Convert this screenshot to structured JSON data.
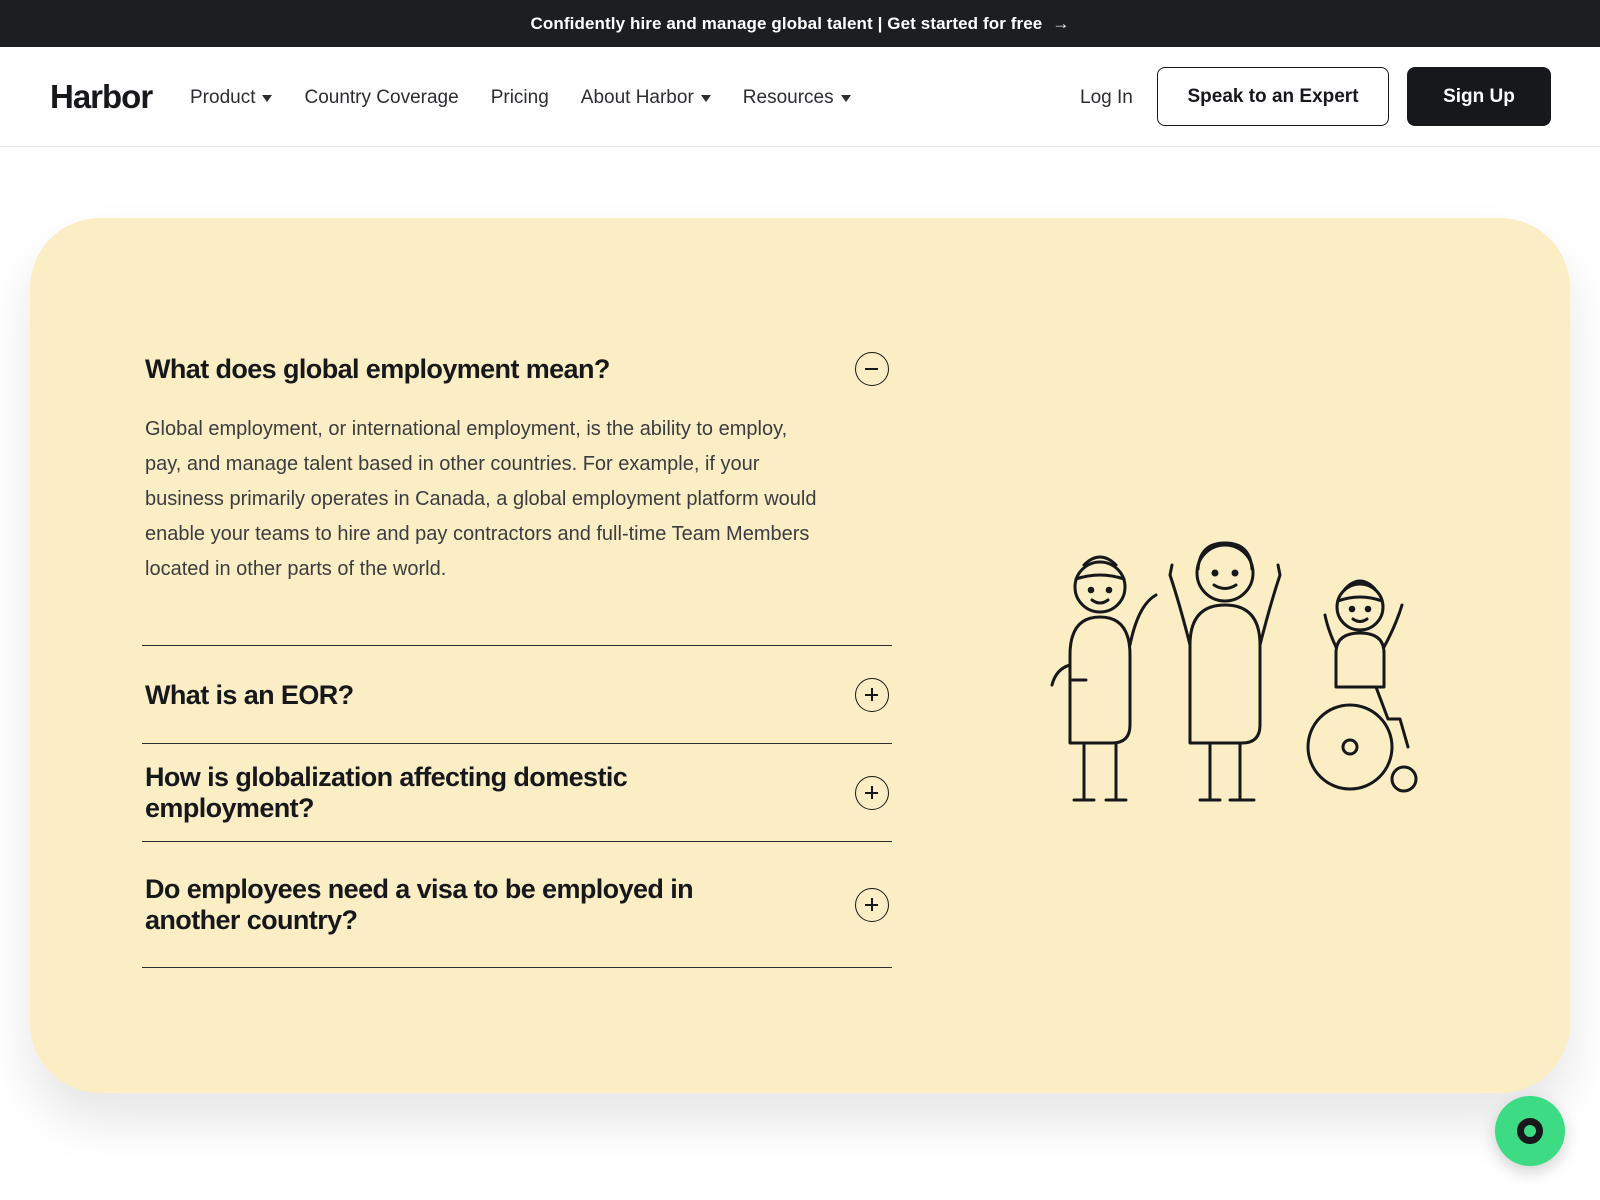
{
  "announcement": {
    "text": "Confidently hire and manage global talent | Get started for free",
    "arrow": "→"
  },
  "nav": {
    "logo": "Harbor",
    "links": [
      {
        "label": "Product",
        "has_dropdown": true
      },
      {
        "label": "Country Coverage",
        "has_dropdown": false
      },
      {
        "label": "Pricing",
        "has_dropdown": false
      },
      {
        "label": "About Harbor",
        "has_dropdown": true
      },
      {
        "label": "Resources",
        "has_dropdown": true
      }
    ],
    "login": "Log In",
    "expert_button": "Speak to an Expert",
    "signup_button": "Sign Up"
  },
  "faq": {
    "items": [
      {
        "question": "What does global employment mean?",
        "expanded": true,
        "answer": "Global employment, or international employment, is the ability to employ, pay, and manage talent based in other countries. For example, if your business primarily operates in Canada, a global employment platform would enable your teams to hire and pay contractors and full-time Team Members located in other parts of the world."
      },
      {
        "question": "What is an EOR?",
        "expanded": false
      },
      {
        "question": "How is globalization affecting domestic employment?",
        "expanded": false
      },
      {
        "question": "Do employees need a visa to be employed in another country?",
        "expanded": false
      }
    ]
  },
  "colors": {
    "card_background": "#fbeec5",
    "dark": "#16181b",
    "chat_button": "#3ddc84"
  },
  "icons": {
    "collapse": "minus-circle-icon",
    "expand": "plus-circle-icon",
    "illustration": "people-celebrating-illustration",
    "chat": "chat-icon"
  }
}
